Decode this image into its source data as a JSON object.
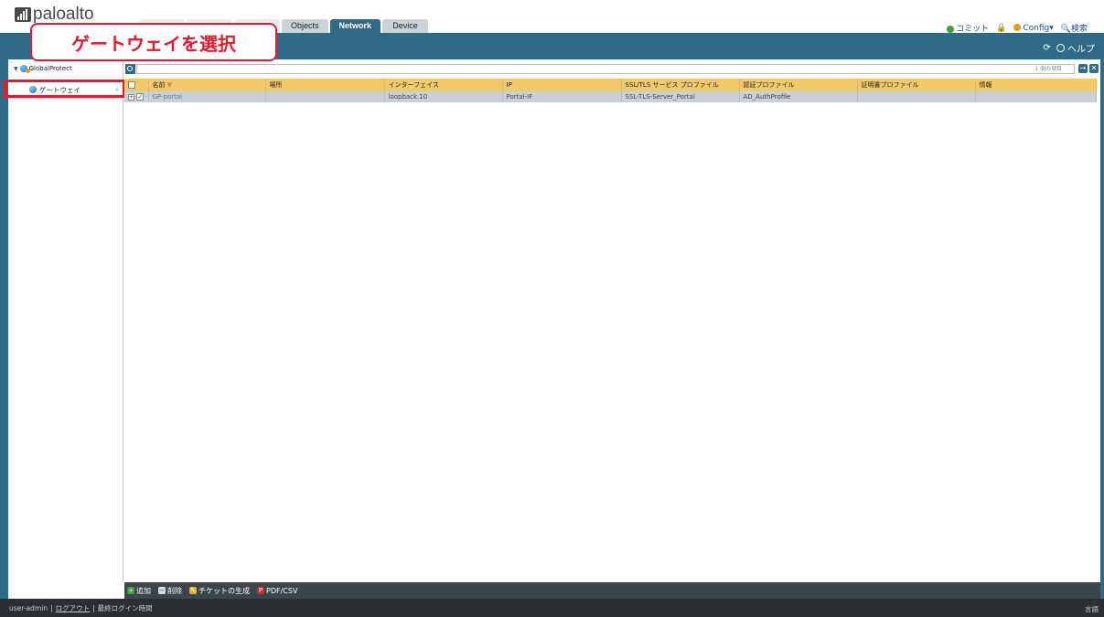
{
  "app": {
    "logo_text": "paloalto"
  },
  "tabs": [
    {
      "label": ""
    },
    {
      "label": ""
    },
    {
      "label": ""
    },
    {
      "label": "Objects"
    },
    {
      "label": "Network"
    },
    {
      "label": "Device"
    }
  ],
  "topright": {
    "commit": "コミット",
    "config": "Config▾",
    "search": "検索"
  },
  "bluebar": {
    "help": "ヘルプ"
  },
  "callout": {
    "text": "ゲートウェイを選択"
  },
  "sidebar": {
    "root_label": "GlobalProtect",
    "selected_item": "ゲートウェイ"
  },
  "search": {
    "placeholder": "",
    "count_text": "1 個の項目"
  },
  "table": {
    "headers": [
      "名前",
      "場所",
      "インターフェイス",
      "IP",
      "SSL/TLS サービス プロファイル",
      "認証プロファイル",
      "証明書プロファイル",
      "情報"
    ],
    "rows": [
      {
        "name": "GP-portal",
        "location": "",
        "interface": "loopback.10",
        "ip": "Portal-IF",
        "ssl": "SSL-TLS-Server_Portal",
        "auth": "AD_AuthProfile",
        "cert": "",
        "info": ""
      }
    ]
  },
  "toolbar": {
    "add": "追加",
    "delete": "削除",
    "ticket": "チケットの生成",
    "pdf": "PDF/CSV"
  },
  "status": {
    "user": "user-admin",
    "logout": "ログアウト",
    "last_login": "最終ログイン時間",
    "language": "言語"
  },
  "colors": {
    "accent": "#2f6b86",
    "header_row": "#f3c96a",
    "callout_red": "#e8192c"
  }
}
